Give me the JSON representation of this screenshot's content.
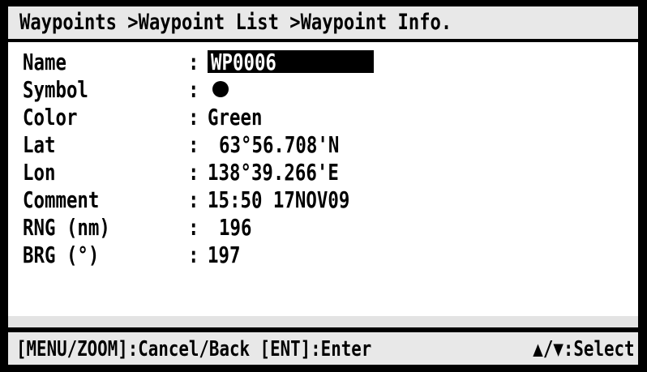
{
  "header": {
    "breadcrumb": "Waypoints >Waypoint List >Waypoint Info."
  },
  "fields": {
    "name": {
      "label": "Name",
      "value": "WP0006"
    },
    "symbol": {
      "label": "Symbol",
      "icon": "filled-circle-icon"
    },
    "color": {
      "label": "Color",
      "value": "Green"
    },
    "lat": {
      "label": "Lat",
      "value": "63°56.708'N"
    },
    "lon": {
      "label": "Lon",
      "value": "138°39.266'E"
    },
    "comment": {
      "label": "Comment",
      "value": "15:50 17NOV09"
    },
    "rng": {
      "label": "RNG (nm)",
      "value": "196"
    },
    "brg": {
      "label": "BRG (°)",
      "value": "197"
    }
  },
  "separator": ":",
  "footer": {
    "left_hint": "[MENU/ZOOM]:Cancel/Back [ENT]:Enter",
    "right_hint": "▲/▼:Select"
  },
  "colors": {
    "frame": "#000000",
    "panel": "#ffffff",
    "bar": "#e8e8e8",
    "highlight_bg": "#000000",
    "highlight_fg": "#ffffff"
  }
}
